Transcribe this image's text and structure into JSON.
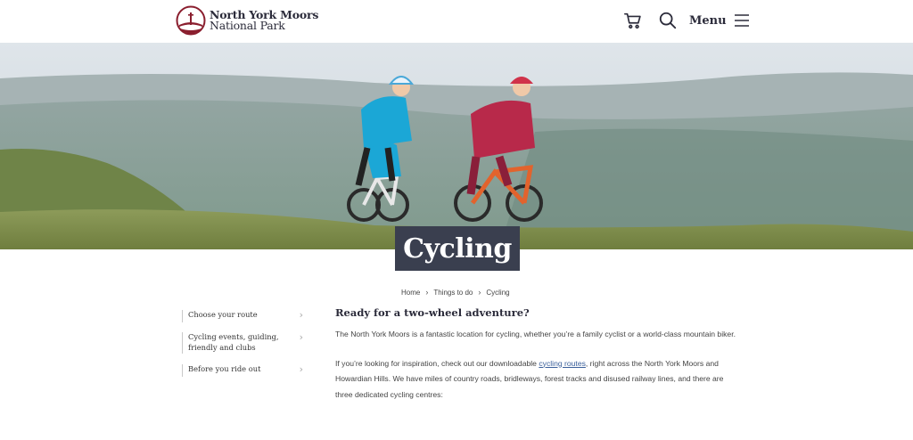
{
  "header": {
    "logo_line1": "North York Moors",
    "logo_line2": "National Park",
    "menu_label": "Menu"
  },
  "page": {
    "title": "Cycling"
  },
  "breadcrumb": {
    "items": [
      "Home",
      "Things to do",
      "Cycling"
    ]
  },
  "sidebar": {
    "items": [
      {
        "label": "Choose your route"
      },
      {
        "label": "Cycling events, guiding, friendly and clubs"
      },
      {
        "label": "Before you ride out"
      }
    ]
  },
  "content": {
    "heading": "Ready for a two-wheel adventure?",
    "para1": "The North York Moors is a fantastic location for cycling, whether you’re a family cyclist or a world-class mountain biker.",
    "para2_before": "If you’re looking for inspiration, check out our downloadable ",
    "para2_link": "cycling routes",
    "para2_after": ", right across the North York Moors and Howardian Hills. We have miles of country roads, bridleways, forest tracks and disused railway lines, and there are three dedicated cycling centres:"
  },
  "icons": {
    "logo": "national-park-logo",
    "cart": "shopping-cart-icon",
    "search": "search-icon",
    "menu": "hamburger-menu-icon",
    "chevron": "chevron-right-icon"
  },
  "colors": {
    "brand": "#8a1e2e",
    "title_box": "#3a3f4f",
    "text_dark": "#2b2b3a",
    "link": "#3a5f9a"
  }
}
